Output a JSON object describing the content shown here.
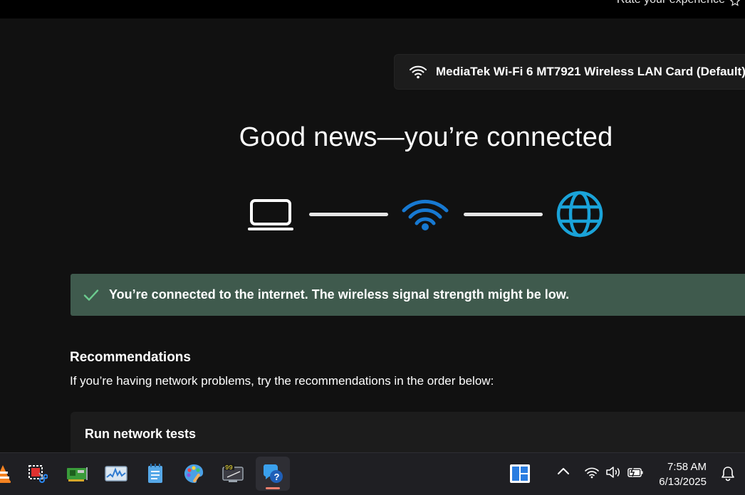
{
  "header": {
    "rate_label": "Rate your experience"
  },
  "adapter": {
    "name": "MediaTek Wi-Fi 6 MT7921 Wireless LAN Card (Default)"
  },
  "hero": {
    "title": "Good news—you’re connected"
  },
  "diagram": {
    "nodes": [
      "laptop-icon",
      "wifi-icon",
      "globe-icon"
    ]
  },
  "status": {
    "message": "You’re connected to the internet. The wireless signal strength might be low."
  },
  "recommendations": {
    "title": "Recommendations",
    "subtitle": "If you’re having network problems, try the recommendations in the order below:",
    "items": [
      {
        "label": "Run network tests"
      }
    ]
  },
  "taskbar": {
    "apps": [
      "vlc-icon",
      "snipping-tool-icon",
      "network-card-icon",
      "resource-monitor-icon",
      "notepad-icon",
      "paint-icon",
      "calculator-monitor-icon",
      "get-help-icon"
    ],
    "active_app": "get-help-icon"
  },
  "tray": {
    "icons": [
      "snap-layout-icon",
      "chevron-up-icon",
      "wifi-icon",
      "volume-icon",
      "battery-icon",
      "bell-icon"
    ],
    "time": "7:58 AM",
    "date": "6/13/2025"
  },
  "colors": {
    "background": "#111111",
    "status_bg": "#3f5a4d",
    "check": "#6ccb8f",
    "wifi_blue": "#1779d2",
    "globe_blue": "#1aa3d9",
    "taskbar_bg": "#1f1f23"
  }
}
